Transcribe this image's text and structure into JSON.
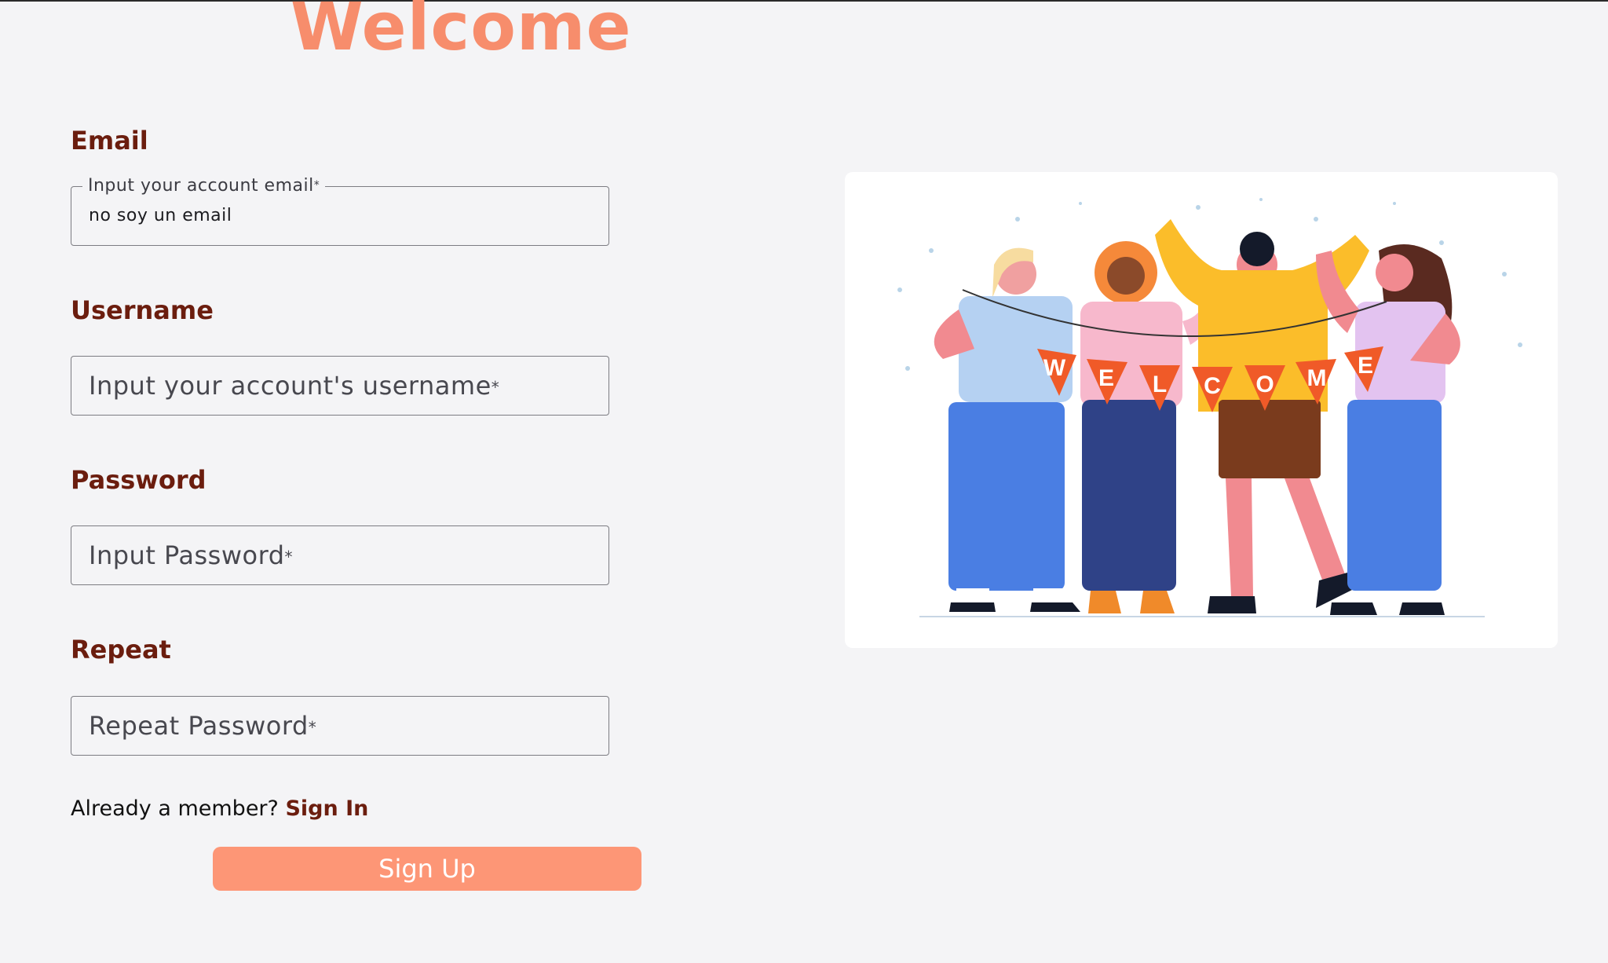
{
  "page": {
    "title": "Welcome"
  },
  "form": {
    "email": {
      "label": "Email",
      "placeholder": "Input your account email",
      "required_mark": "*",
      "value": "no soy un email"
    },
    "username": {
      "label": "Username",
      "placeholder": "Input your account's username",
      "required_mark": "*"
    },
    "password": {
      "label": "Password",
      "placeholder": "Input Password",
      "required_mark": "*"
    },
    "repeat": {
      "label": "Repeat",
      "placeholder": "Repeat Password",
      "required_mark": "*"
    },
    "member_prompt": "Already a member?",
    "sign_in_link": "Sign In",
    "submit_label": "Sign Up"
  },
  "illustration": {
    "banner_letters": [
      "W",
      "E",
      "L",
      "C",
      "O",
      "M",
      "E"
    ]
  },
  "colors": {
    "accent": "#fd9676",
    "title": "#f78d6c",
    "label": "#6b1d0e",
    "background": "#f4f4f6"
  }
}
